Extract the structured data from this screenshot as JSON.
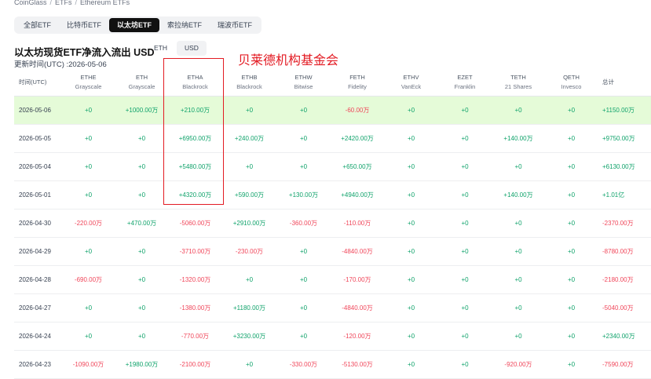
{
  "breadcrumb": [
    "CoinGlass",
    "ETFs",
    "Ethereum ETFs"
  ],
  "tabs": [
    "全部ETF",
    "比特币ETF",
    "以太坊ETF",
    "索拉纳ETF",
    "瑞波币ETF"
  ],
  "active_tab": "以太坊ETF",
  "title": "以太坊现货ETF净流入流出 USD",
  "currency_options": [
    "ETH",
    "USD"
  ],
  "active_currency": "USD",
  "update_time": "更新时间(UTC) :2026-05-06",
  "annotation": "贝莱德机构基金会",
  "colors": {
    "positive": "#10a36b",
    "negative": "#f0465a",
    "highlight_row": "#e5fbd8",
    "annotation": "#e31b23"
  },
  "table": {
    "date_header": "时间(UTC)",
    "total_header": "总计",
    "columns": [
      {
        "ticker": "ETHE",
        "issuer": "Grayscale"
      },
      {
        "ticker": "ETH",
        "issuer": "Grayscale"
      },
      {
        "ticker": "ETHA",
        "issuer": "Blackrock"
      },
      {
        "ticker": "ETHB",
        "issuer": "Blackrock"
      },
      {
        "ticker": "ETHW",
        "issuer": "Bitwise"
      },
      {
        "ticker": "FETH",
        "issuer": "Fidelity"
      },
      {
        "ticker": "ETHV",
        "issuer": "VanEck"
      },
      {
        "ticker": "EZET",
        "issuer": "Franklin"
      },
      {
        "ticker": "TETH",
        "issuer": "21 Shares"
      },
      {
        "ticker": "QETH",
        "issuer": "Invesco"
      }
    ],
    "rows": [
      {
        "date": "2026-05-06",
        "values": [
          "+0",
          "+1000.00万",
          "+210.00万",
          "+0",
          "+0",
          "-60.00万",
          "+0",
          "+0",
          "+0",
          "+0"
        ],
        "total": "+1150.00万"
      },
      {
        "date": "2026-05-05",
        "values": [
          "+0",
          "+0",
          "+6950.00万",
          "+240.00万",
          "+0",
          "+2420.00万",
          "+0",
          "+0",
          "+140.00万",
          "+0"
        ],
        "total": "+9750.00万"
      },
      {
        "date": "2026-05-04",
        "values": [
          "+0",
          "+0",
          "+5480.00万",
          "+0",
          "+0",
          "+650.00万",
          "+0",
          "+0",
          "+0",
          "+0"
        ],
        "total": "+6130.00万"
      },
      {
        "date": "2026-05-01",
        "values": [
          "+0",
          "+0",
          "+4320.00万",
          "+590.00万",
          "+130.00万",
          "+4940.00万",
          "+0",
          "+0",
          "+140.00万",
          "+0"
        ],
        "total": "+1.01亿"
      },
      {
        "date": "2026-04-30",
        "values": [
          "-220.00万",
          "+470.00万",
          "-5060.00万",
          "+2910.00万",
          "-360.00万",
          "-110.00万",
          "+0",
          "+0",
          "+0",
          "+0"
        ],
        "total": "-2370.00万"
      },
      {
        "date": "2026-04-29",
        "values": [
          "+0",
          "+0",
          "-3710.00万",
          "-230.00万",
          "+0",
          "-4840.00万",
          "+0",
          "+0",
          "+0",
          "+0"
        ],
        "total": "-8780.00万"
      },
      {
        "date": "2026-04-28",
        "values": [
          "-690.00万",
          "+0",
          "-1320.00万",
          "+0",
          "+0",
          "-170.00万",
          "+0",
          "+0",
          "+0",
          "+0"
        ],
        "total": "-2180.00万"
      },
      {
        "date": "2026-04-27",
        "values": [
          "+0",
          "+0",
          "-1380.00万",
          "+1180.00万",
          "+0",
          "-4840.00万",
          "+0",
          "+0",
          "+0",
          "+0"
        ],
        "total": "-5040.00万"
      },
      {
        "date": "2026-04-24",
        "values": [
          "+0",
          "+0",
          "-770.00万",
          "+3230.00万",
          "+0",
          "-120.00万",
          "+0",
          "+0",
          "+0",
          "+0"
        ],
        "total": "+2340.00万"
      },
      {
        "date": "2026-04-23",
        "values": [
          "-1090.00万",
          "+1980.00万",
          "-2100.00万",
          "+0",
          "-330.00万",
          "-5130.00万",
          "+0",
          "+0",
          "-920.00万",
          "+0"
        ],
        "total": "-7590.00万"
      }
    ]
  }
}
